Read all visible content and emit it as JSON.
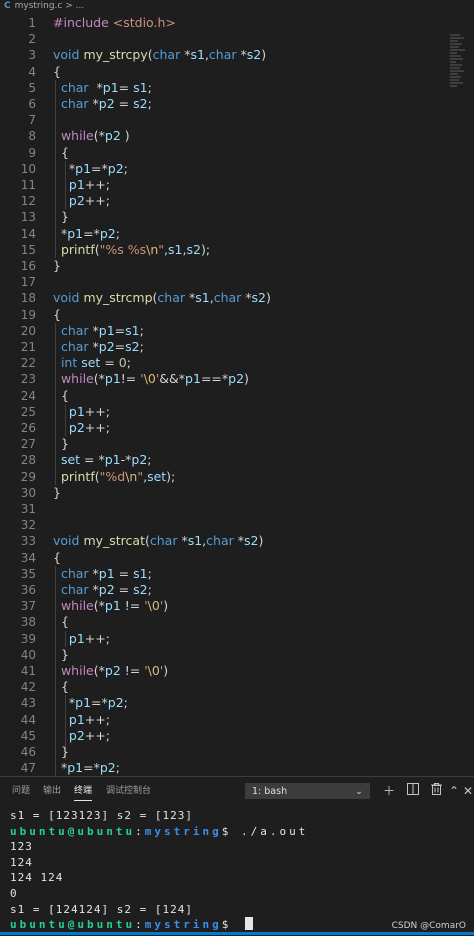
{
  "breadcrumb": {
    "file": "mystring.c",
    "sep": ">",
    "more": "..."
  },
  "editor": {
    "lines": [
      {
        "n": "1",
        "t": [
          [
            "ctl",
            "#include "
          ],
          [
            "str",
            "<stdio.h>"
          ]
        ]
      },
      {
        "n": "2",
        "t": []
      },
      {
        "n": "3",
        "t": [
          [
            "kw",
            "void "
          ],
          [
            "fn",
            "my_strcpy"
          ],
          [
            "p",
            "("
          ],
          [
            "kw",
            "char "
          ],
          [
            "p",
            "*"
          ],
          [
            "var",
            "s1"
          ],
          [
            "p",
            ","
          ],
          [
            "kw",
            "char "
          ],
          [
            "p",
            "*"
          ],
          [
            "var",
            "s2"
          ],
          [
            "p",
            ")"
          ]
        ]
      },
      {
        "n": "4",
        "t": [
          [
            "p",
            "{"
          ]
        ]
      },
      {
        "n": "5",
        "t": [
          [
            "p",
            "  "
          ],
          [
            "kw",
            "char "
          ],
          [
            "p",
            " *"
          ],
          [
            "var",
            "p1"
          ],
          [
            "p",
            "= "
          ],
          [
            "var",
            "s1"
          ],
          [
            "p",
            ";"
          ]
        ]
      },
      {
        "n": "6",
        "t": [
          [
            "p",
            "  "
          ],
          [
            "kw",
            "char "
          ],
          [
            "p",
            "*"
          ],
          [
            "var",
            "p2"
          ],
          [
            "p",
            " = "
          ],
          [
            "var",
            "s2"
          ],
          [
            "p",
            ";"
          ]
        ]
      },
      {
        "n": "7",
        "t": []
      },
      {
        "n": "8",
        "t": [
          [
            "p",
            "  "
          ],
          [
            "ctl",
            "while"
          ],
          [
            "p",
            "(*"
          ],
          [
            "var",
            "p2"
          ],
          [
            "p",
            " )"
          ]
        ]
      },
      {
        "n": "9",
        "t": [
          [
            "p",
            "  {"
          ]
        ]
      },
      {
        "n": "10",
        "t": [
          [
            "p",
            "    *"
          ],
          [
            "var",
            "p1"
          ],
          [
            "p",
            "=*"
          ],
          [
            "var",
            "p2"
          ],
          [
            "p",
            ";"
          ]
        ]
      },
      {
        "n": "11",
        "t": [
          [
            "p",
            "    "
          ],
          [
            "var",
            "p1"
          ],
          [
            "p",
            "++;"
          ]
        ]
      },
      {
        "n": "12",
        "t": [
          [
            "p",
            "    "
          ],
          [
            "var",
            "p2"
          ],
          [
            "p",
            "++;"
          ]
        ]
      },
      {
        "n": "13",
        "t": [
          [
            "p",
            "  }"
          ]
        ]
      },
      {
        "n": "14",
        "t": [
          [
            "p",
            "  *"
          ],
          [
            "var",
            "p1"
          ],
          [
            "p",
            "=*"
          ],
          [
            "var",
            "p2"
          ],
          [
            "p",
            ";"
          ]
        ]
      },
      {
        "n": "15",
        "t": [
          [
            "p",
            "  "
          ],
          [
            "fn",
            "printf"
          ],
          [
            "p",
            "("
          ],
          [
            "str",
            "\"%s %s"
          ],
          [
            "esc",
            "\\n"
          ],
          [
            "str",
            "\""
          ],
          [
            "p",
            ","
          ],
          [
            "var",
            "s1"
          ],
          [
            "p",
            ","
          ],
          [
            "var",
            "s2"
          ],
          [
            "p",
            ");"
          ]
        ]
      },
      {
        "n": "16",
        "t": [
          [
            "p",
            "}"
          ]
        ]
      },
      {
        "n": "17",
        "t": []
      },
      {
        "n": "18",
        "t": [
          [
            "kw",
            "void "
          ],
          [
            "fn",
            "my_strcmp"
          ],
          [
            "p",
            "("
          ],
          [
            "kw",
            "char "
          ],
          [
            "p",
            "*"
          ],
          [
            "var",
            "s1"
          ],
          [
            "p",
            ","
          ],
          [
            "kw",
            "char "
          ],
          [
            "p",
            "*"
          ],
          [
            "var",
            "s2"
          ],
          [
            "p",
            ")"
          ]
        ]
      },
      {
        "n": "19",
        "t": [
          [
            "p",
            "{"
          ]
        ]
      },
      {
        "n": "20",
        "t": [
          [
            "p",
            "  "
          ],
          [
            "kw",
            "char "
          ],
          [
            "p",
            "*"
          ],
          [
            "var",
            "p1"
          ],
          [
            "p",
            "="
          ],
          [
            "var",
            "s1"
          ],
          [
            "p",
            ";"
          ]
        ]
      },
      {
        "n": "21",
        "t": [
          [
            "p",
            "  "
          ],
          [
            "kw",
            "char "
          ],
          [
            "p",
            "*"
          ],
          [
            "var",
            "p2"
          ],
          [
            "p",
            "="
          ],
          [
            "var",
            "s2"
          ],
          [
            "p",
            ";"
          ]
        ]
      },
      {
        "n": "22",
        "t": [
          [
            "p",
            "  "
          ],
          [
            "kw",
            "int "
          ],
          [
            "var",
            "set"
          ],
          [
            "p",
            " = "
          ],
          [
            "num",
            "0"
          ],
          [
            "p",
            ";"
          ]
        ]
      },
      {
        "n": "23",
        "t": [
          [
            "p",
            "  "
          ],
          [
            "ctl",
            "while"
          ],
          [
            "p",
            "(*"
          ],
          [
            "var",
            "p1"
          ],
          [
            "p",
            "!= "
          ],
          [
            "str",
            "'"
          ],
          [
            "esc",
            "\\0"
          ],
          [
            "str",
            "'"
          ],
          [
            "p",
            "&&*"
          ],
          [
            "var",
            "p1"
          ],
          [
            "p",
            "==*"
          ],
          [
            "var",
            "p2"
          ],
          [
            "p",
            ")"
          ]
        ]
      },
      {
        "n": "24",
        "t": [
          [
            "p",
            "  {"
          ]
        ]
      },
      {
        "n": "25",
        "t": [
          [
            "p",
            "    "
          ],
          [
            "var",
            "p1"
          ],
          [
            "p",
            "++;"
          ]
        ]
      },
      {
        "n": "26",
        "t": [
          [
            "p",
            "    "
          ],
          [
            "var",
            "p2"
          ],
          [
            "p",
            "++;"
          ]
        ]
      },
      {
        "n": "27",
        "t": [
          [
            "p",
            "  }"
          ]
        ]
      },
      {
        "n": "28",
        "t": [
          [
            "p",
            "  "
          ],
          [
            "var",
            "set"
          ],
          [
            "p",
            " = *"
          ],
          [
            "var",
            "p1"
          ],
          [
            "p",
            "-*"
          ],
          [
            "var",
            "p2"
          ],
          [
            "p",
            ";"
          ]
        ]
      },
      {
        "n": "29",
        "t": [
          [
            "p",
            "  "
          ],
          [
            "fn",
            "printf"
          ],
          [
            "p",
            "("
          ],
          [
            "str",
            "\"%d"
          ],
          [
            "esc",
            "\\n"
          ],
          [
            "str",
            "\""
          ],
          [
            "p",
            ","
          ],
          [
            "var",
            "set"
          ],
          [
            "p",
            ");"
          ]
        ]
      },
      {
        "n": "30",
        "t": [
          [
            "p",
            "}"
          ]
        ]
      },
      {
        "n": "31",
        "t": []
      },
      {
        "n": "32",
        "t": []
      },
      {
        "n": "33",
        "t": [
          [
            "kw",
            "void "
          ],
          [
            "fn",
            "my_strcat"
          ],
          [
            "p",
            "("
          ],
          [
            "kw",
            "char "
          ],
          [
            "p",
            "*"
          ],
          [
            "var",
            "s1"
          ],
          [
            "p",
            ","
          ],
          [
            "kw",
            "char "
          ],
          [
            "p",
            "*"
          ],
          [
            "var",
            "s2"
          ],
          [
            "p",
            ")"
          ]
        ]
      },
      {
        "n": "34",
        "t": [
          [
            "p",
            "{"
          ]
        ]
      },
      {
        "n": "35",
        "t": [
          [
            "p",
            "  "
          ],
          [
            "kw",
            "char "
          ],
          [
            "p",
            "*"
          ],
          [
            "var",
            "p1"
          ],
          [
            "p",
            " = "
          ],
          [
            "var",
            "s1"
          ],
          [
            "p",
            ";"
          ]
        ]
      },
      {
        "n": "36",
        "t": [
          [
            "p",
            "  "
          ],
          [
            "kw",
            "char "
          ],
          [
            "p",
            "*"
          ],
          [
            "var",
            "p2"
          ],
          [
            "p",
            " = "
          ],
          [
            "var",
            "s2"
          ],
          [
            "p",
            ";"
          ]
        ]
      },
      {
        "n": "37",
        "t": [
          [
            "p",
            "  "
          ],
          [
            "ctl",
            "while"
          ],
          [
            "p",
            "(*"
          ],
          [
            "var",
            "p1"
          ],
          [
            "p",
            " != "
          ],
          [
            "str",
            "'"
          ],
          [
            "esc",
            "\\0"
          ],
          [
            "str",
            "'"
          ],
          [
            "p",
            ")"
          ]
        ]
      },
      {
        "n": "38",
        "t": [
          [
            "p",
            "  {"
          ]
        ]
      },
      {
        "n": "39",
        "t": [
          [
            "p",
            "    "
          ],
          [
            "var",
            "p1"
          ],
          [
            "p",
            "++;"
          ]
        ]
      },
      {
        "n": "40",
        "t": [
          [
            "p",
            "  }"
          ]
        ]
      },
      {
        "n": "41",
        "t": [
          [
            "p",
            "  "
          ],
          [
            "ctl",
            "while"
          ],
          [
            "p",
            "(*"
          ],
          [
            "var",
            "p2"
          ],
          [
            "p",
            " != "
          ],
          [
            "str",
            "'"
          ],
          [
            "esc",
            "\\0"
          ],
          [
            "str",
            "'"
          ],
          [
            "p",
            ")"
          ]
        ]
      },
      {
        "n": "42",
        "t": [
          [
            "p",
            "  {"
          ]
        ]
      },
      {
        "n": "43",
        "t": [
          [
            "p",
            "    *"
          ],
          [
            "var",
            "p1"
          ],
          [
            "p",
            "=*"
          ],
          [
            "var",
            "p2"
          ],
          [
            "p",
            ";"
          ]
        ]
      },
      {
        "n": "44",
        "t": [
          [
            "p",
            "    "
          ],
          [
            "var",
            "p1"
          ],
          [
            "p",
            "++;"
          ]
        ]
      },
      {
        "n": "45",
        "t": [
          [
            "p",
            "    "
          ],
          [
            "var",
            "p2"
          ],
          [
            "p",
            "++;"
          ]
        ]
      },
      {
        "n": "46",
        "t": [
          [
            "p",
            "  }"
          ]
        ]
      },
      {
        "n": "47",
        "t": [
          [
            "p",
            "  *"
          ],
          [
            "var",
            "p1"
          ],
          [
            "p",
            "=*"
          ],
          [
            "var",
            "p2"
          ],
          [
            "p",
            ";"
          ]
        ]
      }
    ]
  },
  "panel": {
    "tabs": [
      "问题",
      "输出",
      "终端",
      "调试控制台"
    ],
    "active_tab": "终端",
    "terminal_select": "1: bash",
    "icons": [
      "plus-icon",
      "split-icon",
      "trash-icon",
      "chevron-up-icon",
      "close-icon"
    ]
  },
  "terminal": {
    "lines": [
      {
        "type": "out",
        "text": "s1 = [123123] s2 = [123]"
      },
      {
        "type": "prompt",
        "user": "ubuntu@ubuntu",
        "sep": ":",
        "path": "mystring",
        "sym": "$",
        "cmd": " ./a.out"
      },
      {
        "type": "out",
        "text": "123"
      },
      {
        "type": "out",
        "text": "124"
      },
      {
        "type": "out",
        "text": "124 124"
      },
      {
        "type": "out",
        "text": "0"
      },
      {
        "type": "out",
        "text": "s1 = [124124] s2 = [124]"
      },
      {
        "type": "prompt",
        "user": "ubuntu@ubuntu",
        "sep": ":",
        "path": "mystring",
        "sym": "$",
        "cmd": " ",
        "cursor": true
      }
    ]
  },
  "watermark": "CSDN @ComarO",
  "colors": {
    "background": "#1e1e1e",
    "keyword": "#569cd6",
    "control": "#c586c0",
    "function": "#dcdcaa",
    "string": "#ce9178",
    "variable": "#9cdcfe",
    "number": "#b5cea8",
    "prompt_user": "#23d18b",
    "prompt_path": "#3b8eea",
    "accent": "#007acc"
  }
}
